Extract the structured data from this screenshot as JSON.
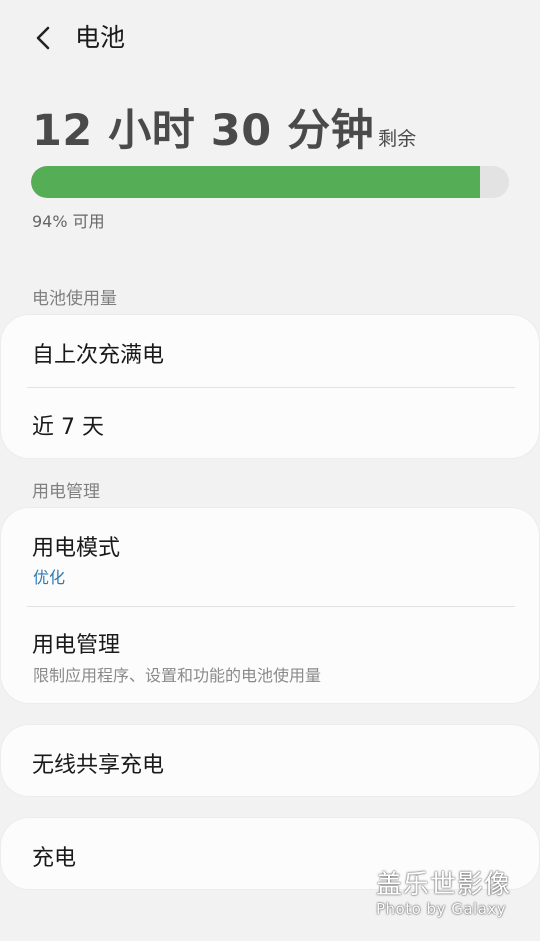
{
  "header": {
    "title": "电池",
    "back_icon": "chevron-left-icon"
  },
  "battery": {
    "time_remaining": "12 小时 30 分钟",
    "remaining_suffix": "剩余",
    "level_percent": 94,
    "available_text": "94% 可用",
    "bar_color": "#55ad55"
  },
  "usage_section": {
    "title": "电池使用量",
    "items": [
      {
        "label": "自上次充满电"
      },
      {
        "label": "近 7 天"
      }
    ]
  },
  "power_section": {
    "title": "用电管理",
    "items": [
      {
        "label": "用电模式",
        "sub": "优化"
      },
      {
        "label": "用电管理",
        "sub": "限制应用程序、设置和功能的电池使用量"
      }
    ]
  },
  "wireless_share": {
    "label": "无线共享充电"
  },
  "charging": {
    "label": "充电"
  },
  "watermark": {
    "line1": "盖乐世影像",
    "line2": "Photo by Galaxy"
  },
  "colors": {
    "accent_blue": "#2d7bb5",
    "background": "#f2f2f2",
    "card": "#fcfcfc"
  }
}
